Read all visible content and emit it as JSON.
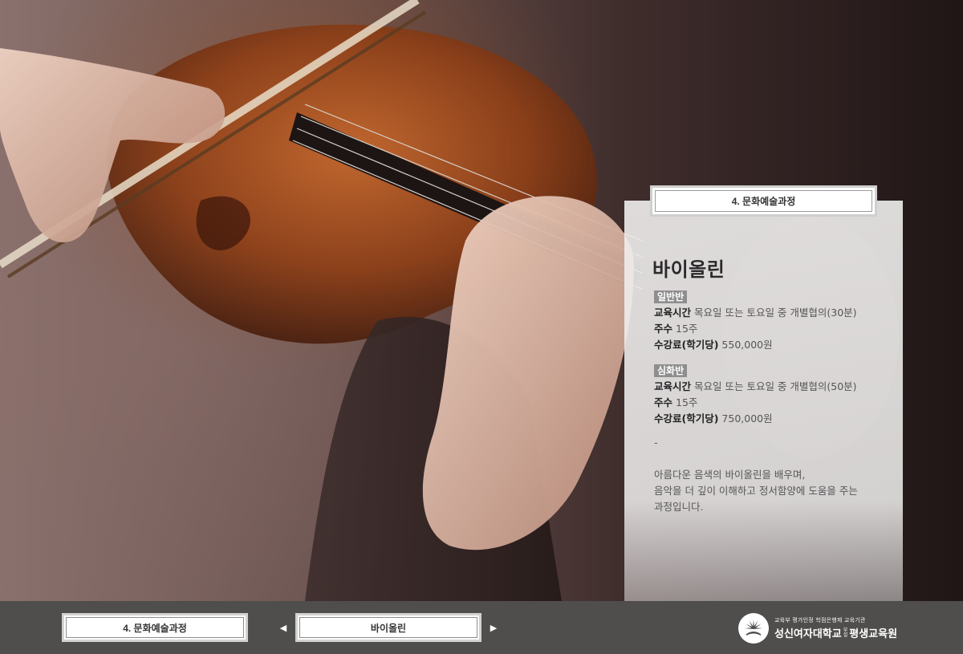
{
  "category_tab": {
    "label": "4. 문화예술과정"
  },
  "course": {
    "title": "바이올린",
    "classes": [
      {
        "badge": "일반반",
        "rows": [
          {
            "label": "교육시간",
            "value": "목요일 또는 토요일 중 개별협의(30분)"
          },
          {
            "label": "주수",
            "value": "15주"
          },
          {
            "label": "수강료(학기당)",
            "value": "550,000원"
          }
        ]
      },
      {
        "badge": "심화반",
        "rows": [
          {
            "label": "교육시간",
            "value": "목요일 또는 토요일 중 개별협의(50분)"
          },
          {
            "label": "주수",
            "value": "15주"
          },
          {
            "label": "수강료(학기당)",
            "value": "750,000원"
          }
        ]
      }
    ],
    "separator": "-",
    "description": [
      "아름다운 음색의 바이올린을 배우며,",
      "음악을 더 깊이 이해하고 정서함양에 도움을 주는",
      "과정입니다."
    ]
  },
  "bottom_nav": {
    "category": "4. 문화예술과정",
    "current": "바이올린",
    "prev_icon": "triangle-left-icon",
    "next_icon": "triangle-right-icon"
  },
  "logo": {
    "sub": "교육부 평가인정 학점은행제 교육기관",
    "name_part1": "성신여자대학교",
    "tiny_top": "부",
    "tiny_bottom": "설",
    "name_part2": "평생교육원"
  },
  "colors": {
    "bar": "#4f4e4d",
    "badge": "#8e8e8e",
    "panel": "#efeded"
  }
}
